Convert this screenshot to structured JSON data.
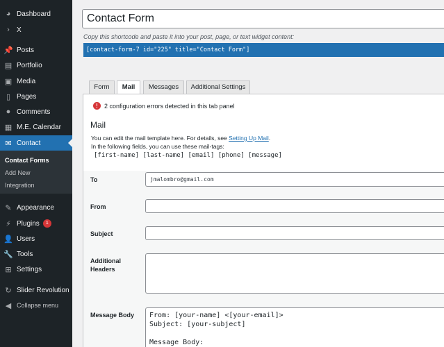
{
  "sidebar": {
    "items": [
      {
        "label": "Dashboard",
        "icon": "dashboard-icon"
      },
      {
        "label": "X",
        "icon": "chevron-right-icon"
      },
      {
        "label": "Posts",
        "icon": "pin-icon"
      },
      {
        "label": "Portfolio",
        "icon": "portfolio-icon"
      },
      {
        "label": "Media",
        "icon": "media-icon"
      },
      {
        "label": "Pages",
        "icon": "pages-icon"
      },
      {
        "label": "Comments",
        "icon": "comments-icon"
      },
      {
        "label": "M.E. Calendar",
        "icon": "calendar-icon"
      },
      {
        "label": "Contact",
        "icon": "mail-icon"
      },
      {
        "label": "Appearance",
        "icon": "brush-icon"
      },
      {
        "label": "Plugins",
        "icon": "plugin-icon",
        "badge": "1"
      },
      {
        "label": "Users",
        "icon": "user-icon"
      },
      {
        "label": "Tools",
        "icon": "wrench-icon"
      },
      {
        "label": "Settings",
        "icon": "settings-icon"
      },
      {
        "label": "Slider Revolution",
        "icon": "refresh-icon"
      },
      {
        "label": "Collapse menu",
        "icon": "collapse-icon"
      }
    ],
    "submenu": [
      "Contact Forms",
      "Add New",
      "Integration"
    ]
  },
  "form": {
    "title": "Contact Form",
    "shortcode_hint": "Copy this shortcode and paste it into your post, page, or text widget content:",
    "shortcode": "[contact-form-7 id=\"225\" title=\"Contact Form\"]"
  },
  "tabs": [
    "Form",
    "Mail",
    "Messages",
    "Additional Settings"
  ],
  "panel": {
    "error": "2 configuration errors detected in this tab panel",
    "title": "Mail",
    "desc1": "You can edit the mail template here. For details, see",
    "desc1_link": "Setting Up Mail",
    "desc1_end": ".",
    "desc2": "In the following fields, you can use these mail-tags:",
    "mail_tags": "[first-name] [last-name] [email] [phone] [message]"
  },
  "fields": {
    "to_label": "To",
    "to_value": "jmalombro@gmail.com",
    "from_label": "From",
    "from_value": "",
    "subject_label": "Subject",
    "subject_value": "",
    "headers_label": "Additional Headers",
    "body_label": "Message Body",
    "body_line1": "From: [your-name] <[your-email]>",
    "body_line2": "Subject: [your-subject]",
    "body_line3": "",
    "body_line4": "Message Body:"
  },
  "colors": {
    "accent": "#2271b1",
    "sidebar": "#1d2327",
    "error": "#d63638"
  }
}
